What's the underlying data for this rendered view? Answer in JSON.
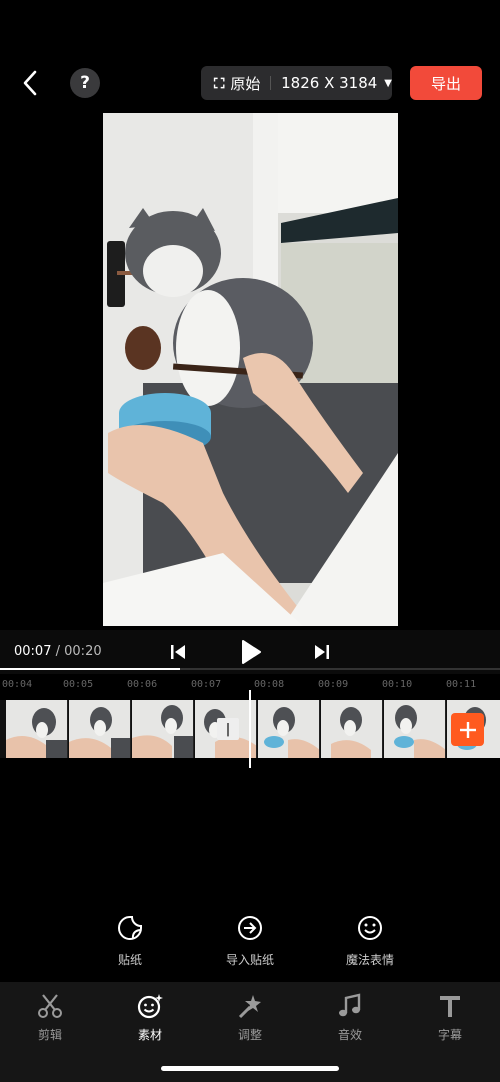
{
  "topbar": {
    "ratio_label": "原始",
    "resolution": "1826 X 3184",
    "export_label": "导出",
    "help_label": "?"
  },
  "player": {
    "current_time": "00:07",
    "separator": "/",
    "total_time": "00:20",
    "progress": 0.36
  },
  "ruler": {
    "ticks": [
      "00:04",
      "00:05",
      "00:06",
      "00:07",
      "00:08",
      "00:09",
      "00:10",
      "00:11"
    ]
  },
  "timeline": {
    "split_handle_label": "|"
  },
  "tools": [
    {
      "label": "贴纸",
      "icon": "sticker-icon"
    },
    {
      "label": "导入贴纸",
      "icon": "import-sticker-icon"
    },
    {
      "label": "魔法表情",
      "icon": "magic-emoji-icon"
    }
  ],
  "tabs": [
    {
      "label": "剪辑",
      "icon": "scissors-icon",
      "active": false
    },
    {
      "label": "素材",
      "icon": "smiley-sparkle-icon",
      "active": true
    },
    {
      "label": "调整",
      "icon": "adjust-icon",
      "active": false
    },
    {
      "label": "音效",
      "icon": "music-note-icon",
      "active": false
    },
    {
      "label": "字幕",
      "icon": "text-icon",
      "active": false
    }
  ],
  "colors": {
    "export": "#f24a3a",
    "add_clip": "#ff5a1f",
    "background": "#000000",
    "tab_bar": "#161616"
  }
}
